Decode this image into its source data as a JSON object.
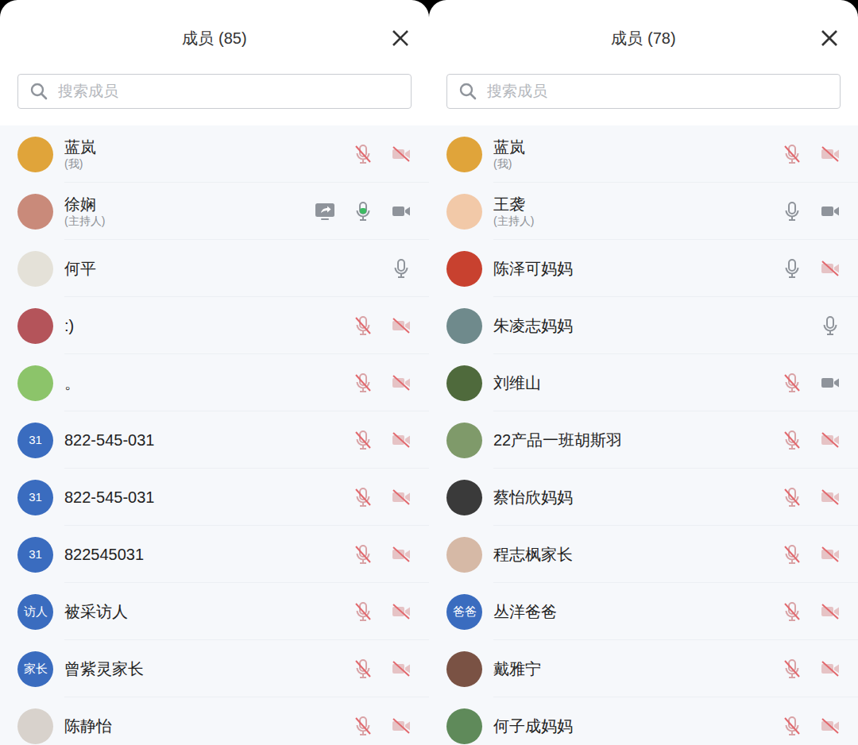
{
  "panels": [
    {
      "title": "成员 (85)",
      "search": {
        "placeholder": "搜索成员"
      },
      "members": [
        {
          "name": "蓝岚",
          "role": "(我)",
          "avatar": {
            "kind": "photo",
            "color": "#e0a43a"
          },
          "sharing": false,
          "mic_on": false,
          "speaking": false,
          "camera_shown": true,
          "camera_on": false
        },
        {
          "name": "徐娴",
          "role": "(主持人)",
          "avatar": {
            "kind": "photo",
            "color": "#c98a7a"
          },
          "sharing": true,
          "mic_on": true,
          "speaking": true,
          "camera_shown": true,
          "camera_on": true
        },
        {
          "name": "何平",
          "avatar": {
            "kind": "photo",
            "color": "#e4e1d8"
          },
          "sharing": false,
          "mic_on": true,
          "speaking": false,
          "camera_shown": false
        },
        {
          "name": ":)",
          "avatar": {
            "kind": "photo",
            "color": "#b4545a"
          },
          "sharing": false,
          "mic_on": false,
          "speaking": false,
          "camera_shown": true,
          "camera_on": false
        },
        {
          "name": "。",
          "avatar": {
            "kind": "photo",
            "color": "#8cc46a"
          },
          "sharing": false,
          "mic_on": false,
          "speaking": false,
          "camera_shown": true,
          "camera_on": false
        },
        {
          "name": "822-545-031",
          "avatar": {
            "kind": "badge",
            "text": "31"
          },
          "sharing": false,
          "mic_on": false,
          "speaking": false,
          "camera_shown": true,
          "camera_on": false
        },
        {
          "name": "822-545-031",
          "avatar": {
            "kind": "badge",
            "text": "31"
          },
          "sharing": false,
          "mic_on": false,
          "speaking": false,
          "camera_shown": true,
          "camera_on": false
        },
        {
          "name": "822545031",
          "avatar": {
            "kind": "badge",
            "text": "31"
          },
          "sharing": false,
          "mic_on": false,
          "speaking": false,
          "camera_shown": true,
          "camera_on": false
        },
        {
          "name": "被采访人",
          "avatar": {
            "kind": "badge",
            "text": "访人"
          },
          "sharing": false,
          "mic_on": false,
          "speaking": false,
          "camera_shown": true,
          "camera_on": false
        },
        {
          "name": "曾紫灵家长",
          "avatar": {
            "kind": "badge",
            "text": "家长"
          },
          "sharing": false,
          "mic_on": false,
          "speaking": false,
          "camera_shown": true,
          "camera_on": false
        },
        {
          "name": "陈静怡",
          "avatar": {
            "kind": "photo",
            "color": "#d8d2cc"
          },
          "sharing": false,
          "mic_on": false,
          "speaking": false,
          "camera_shown": true,
          "camera_on": false
        }
      ]
    },
    {
      "title": "成员 (78)",
      "search": {
        "placeholder": "搜索成员"
      },
      "members": [
        {
          "name": "蓝岚",
          "role": "(我)",
          "avatar": {
            "kind": "photo",
            "color": "#e0a43a"
          },
          "sharing": false,
          "mic_on": false,
          "speaking": false,
          "camera_shown": true,
          "camera_on": false
        },
        {
          "name": "王袭",
          "role": "(主持人)",
          "avatar": {
            "kind": "photo",
            "color": "#f2c9a8"
          },
          "sharing": false,
          "mic_on": true,
          "speaking": false,
          "camera_shown": true,
          "camera_on": true
        },
        {
          "name": "陈泽可妈妈",
          "avatar": {
            "kind": "photo",
            "color": "#c8412f"
          },
          "sharing": false,
          "mic_on": true,
          "speaking": false,
          "camera_shown": true,
          "camera_on": false
        },
        {
          "name": "朱凌志妈妈",
          "avatar": {
            "kind": "photo",
            "color": "#6f8a8c"
          },
          "sharing": false,
          "mic_on": true,
          "speaking": false,
          "camera_shown": false
        },
        {
          "name": "刘维山",
          "avatar": {
            "kind": "photo",
            "color": "#4f6a3c"
          },
          "sharing": false,
          "mic_on": false,
          "speaking": false,
          "camera_shown": true,
          "camera_on": true
        },
        {
          "name": "22产品一班胡斯羽",
          "avatar": {
            "kind": "photo",
            "color": "#7f9a6a"
          },
          "sharing": false,
          "mic_on": false,
          "speaking": false,
          "camera_shown": true,
          "camera_on": false
        },
        {
          "name": "蔡怡欣妈妈",
          "avatar": {
            "kind": "photo",
            "color": "#3a3a3a"
          },
          "sharing": false,
          "mic_on": false,
          "speaking": false,
          "camera_shown": true,
          "camera_on": false
        },
        {
          "name": "程志枫家长",
          "avatar": {
            "kind": "photo",
            "color": "#d6b9a6"
          },
          "sharing": false,
          "mic_on": false,
          "speaking": false,
          "camera_shown": true,
          "camera_on": false
        },
        {
          "name": "丛洋爸爸",
          "avatar": {
            "kind": "badge",
            "text": "爸爸"
          },
          "sharing": false,
          "mic_on": false,
          "speaking": false,
          "camera_shown": true,
          "camera_on": false
        },
        {
          "name": "戴雅宁",
          "avatar": {
            "kind": "photo",
            "color": "#7a5244"
          },
          "sharing": false,
          "mic_on": false,
          "speaking": false,
          "camera_shown": true,
          "camera_on": false
        },
        {
          "name": "何子成妈妈",
          "avatar": {
            "kind": "photo",
            "color": "#5f8a5a"
          },
          "sharing": false,
          "mic_on": false,
          "speaking": false,
          "camera_shown": true,
          "camera_on": false
        }
      ]
    }
  ]
}
